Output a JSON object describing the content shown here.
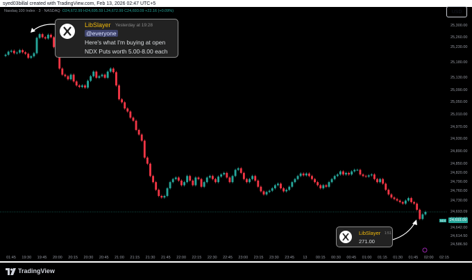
{
  "header": {
    "credit": "syed03billal created with TradingView.com, Feb 13, 2026 02:47 UTC+5",
    "currency": "USD"
  },
  "legend": {
    "symbol": "Nasdaq 100 Index · 3 · NASDAQ",
    "ohlc": "O24,672.99 H24,695.59 L24,672.99 C24,693.09 +22.16 (+0.09%)"
  },
  "chart_data": {
    "type": "candlestick",
    "ylim": [
      24564,
      25338
    ],
    "yticks": [
      "25,300.00",
      "25,260.00",
      "25,230.00",
      "25,180.00",
      "25,130.00",
      "25,090.00",
      "25,050.00",
      "25,010.00",
      "24,970.00",
      "24,930.00",
      "24,890.00",
      "24,850.00",
      "24,820.00",
      "24,790.00",
      "24,760.00",
      "24,730.00",
      "24,693.09",
      "24,670.00",
      "24,642.00",
      "24,614.50",
      "24,586.50"
    ],
    "ytick_values": [
      25300,
      25260,
      25230,
      25180,
      25130,
      25090,
      25050,
      25010,
      24970,
      24930,
      24890,
      24850,
      24820,
      24790,
      24760,
      24730,
      24693.09,
      24670,
      24642,
      24614.5,
      24586.5
    ],
    "xticks": [
      "01:45",
      "19:30",
      "19:45",
      "20:00",
      "20:15",
      "20:30",
      "20:45",
      "21:00",
      "21:15",
      "21:30",
      "21:45",
      "22:00",
      "22:15",
      "22:30",
      "22:45",
      "23:00",
      "23:15",
      "23:30",
      "23:45",
      "13",
      "00:15",
      "00:30",
      "00:45",
      "01:00",
      "01:15",
      "01:30",
      "01:45",
      "02:00",
      "02:15"
    ],
    "last_price": "24,693.09",
    "price_tag": "NDX",
    "up_color": "#26a69a",
    "down_color": "#f23645",
    "closes": [
      25205,
      25215,
      25218,
      25210,
      25212,
      25220,
      25213,
      25208,
      25195,
      25200,
      25210,
      25260,
      25272,
      25262,
      25258,
      25270,
      25262,
      25230,
      25200,
      25160,
      25140,
      25135,
      25125,
      25140,
      25118,
      25105,
      25100,
      25105,
      25098,
      25120,
      25135,
      25150,
      25130,
      25135,
      25140,
      25130,
      25150,
      25160,
      25148,
      25105,
      25060,
      25050,
      25030,
      25020,
      25000,
      24990,
      24960,
      24945,
      24925,
      24870,
      24850,
      24810,
      24790,
      24765,
      24745,
      24740,
      24745,
      24770,
      24790,
      24800,
      24805,
      24795,
      24780,
      24790,
      24810,
      24795,
      24780,
      24805,
      24800,
      24775,
      24790,
      24805,
      24810,
      24800,
      24790,
      24808,
      24815,
      24820,
      24805,
      24790,
      24810,
      24830,
      24835,
      24820,
      24800,
      24790,
      24800,
      24810,
      24795,
      24775,
      24760,
      24750,
      24758,
      24762,
      24770,
      24780,
      24785,
      24770,
      24760,
      24765,
      24775,
      24790,
      24800,
      24810,
      24818,
      24812,
      24818,
      24810,
      24800,
      24790,
      24780,
      24770,
      24780,
      24775,
      24790,
      24800,
      24810,
      24815,
      24825,
      24815,
      24820,
      24815,
      24825,
      24830,
      24830,
      24815,
      24810,
      24808,
      24812,
      24815,
      24800,
      24790,
      24800,
      24785,
      24765,
      24750,
      24740,
      24735,
      24730,
      24725,
      24720,
      24730,
      24738,
      24725,
      24720,
      24700,
      24670,
      24685,
      24693
    ]
  },
  "note1": {
    "user": "LibSlayer",
    "time": "Yesterday at 19:28",
    "mention": "@everyone",
    "line1": "Here's what I'm buying at open",
    "line2": "NDX Puts worth 5.00-8.00 each"
  },
  "note2": {
    "user": "LibSlayer",
    "time": "1:51",
    "value": "271.00"
  },
  "footer": {
    "brand": "TradingView"
  }
}
